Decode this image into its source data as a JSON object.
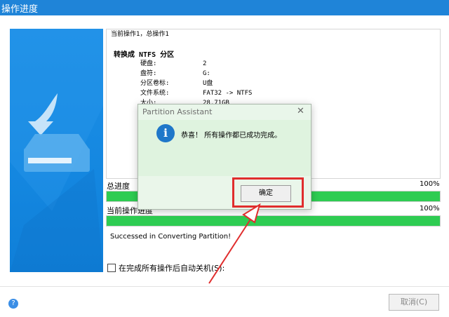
{
  "window": {
    "title": "操作进度"
  },
  "log": {
    "summary": "当前操作1，总操作1",
    "operation": "转换成 NTFS 分区",
    "rows": [
      {
        "key": "硬盘:",
        "value": "2"
      },
      {
        "key": "盘符:",
        "value": "G:"
      },
      {
        "key": "分区卷标:",
        "value": "U盘"
      },
      {
        "key": "文件系统:",
        "value": "FAT32 -> NTFS"
      },
      {
        "key": "大小:",
        "value": "28.71GB"
      }
    ]
  },
  "progress": {
    "total_label": "总进度",
    "total_percent_text": "100%",
    "total_value": 1.0,
    "current_label": "当前操作进度",
    "current_percent_text": "100%",
    "current_value": 1.0,
    "bar_color": "#2ecc52"
  },
  "status_message": "Successed in Converting Partition!",
  "shutdown_option": {
    "label": "在完成所有操作后自动关机(S):",
    "checked": false
  },
  "footer": {
    "cancel_label": "取消(C)",
    "help_icon": "question-icon"
  },
  "dialog": {
    "title": "Partition Assistant",
    "close_glyph": "✕",
    "icon": "info-icon",
    "icon_glyph": "i",
    "message": "恭喜！ 所有操作都已成功完成。",
    "ok_label": "确定"
  },
  "colors": {
    "title_bar": "#1f84d8",
    "side_panel": "#1487e0",
    "highlight": "#e02d2d",
    "dialog_bg": "#e9f6ea"
  }
}
